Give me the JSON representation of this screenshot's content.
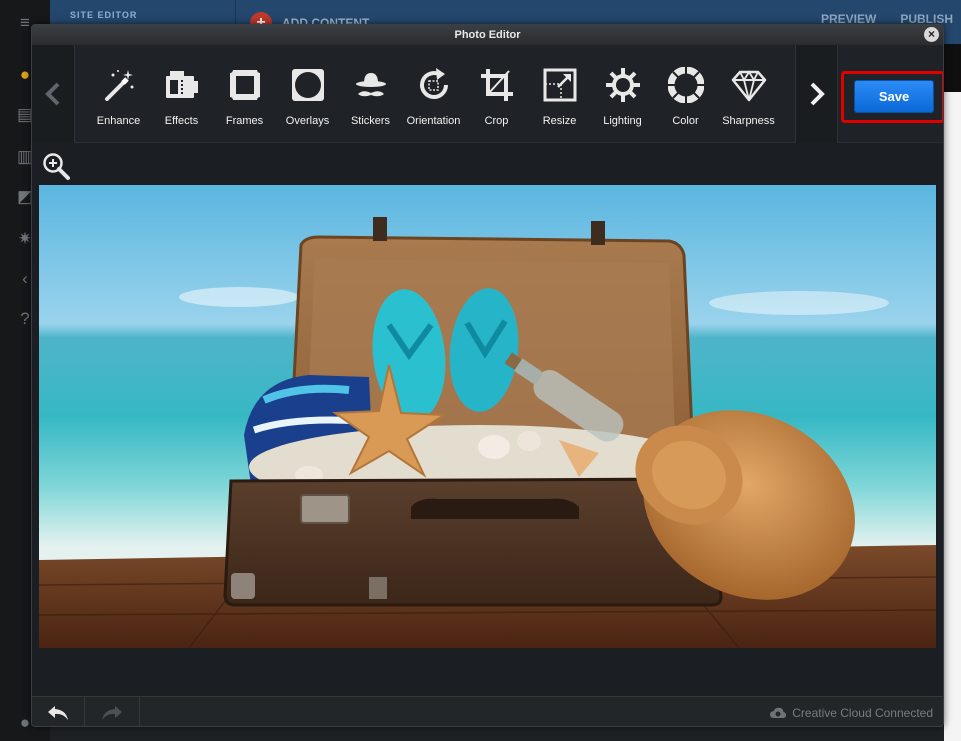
{
  "background": {
    "site_label": "SITE EDITOR",
    "add_content": "ADD CONTENT",
    "preview": "PREVIEW",
    "publish": "PUBLISH"
  },
  "dialog": {
    "title": "Photo Editor",
    "close_symbol": "×"
  },
  "toolbar": {
    "tools": [
      {
        "label": "Enhance",
        "icon": "magic-wand-icon"
      },
      {
        "label": "Effects",
        "icon": "film-icon"
      },
      {
        "label": "Frames",
        "icon": "frame-icon"
      },
      {
        "label": "Overlays",
        "icon": "overlay-icon"
      },
      {
        "label": "Stickers",
        "icon": "hat-mustache-icon"
      },
      {
        "label": "Orientation",
        "icon": "rotate-icon"
      },
      {
        "label": "Crop",
        "icon": "crop-icon"
      },
      {
        "label": "Resize",
        "icon": "resize-icon"
      },
      {
        "label": "Lighting",
        "icon": "sun-icon"
      },
      {
        "label": "Color",
        "icon": "color-ring-icon"
      },
      {
        "label": "Sharpness",
        "icon": "diamond-icon"
      }
    ],
    "save_label": "Save"
  },
  "footer": {
    "status": "Creative Cloud Connected"
  },
  "colors": {
    "accent": "#1677ea",
    "highlight": "#e00000"
  }
}
